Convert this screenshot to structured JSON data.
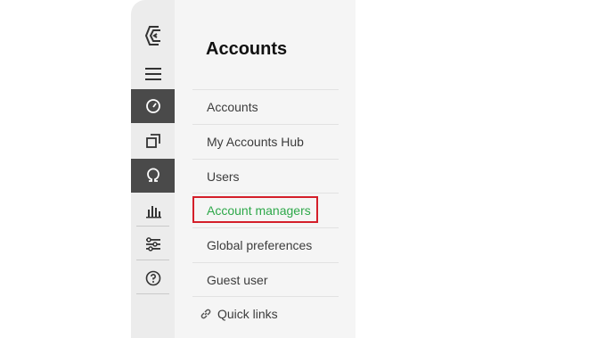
{
  "rail": {
    "items": [
      {
        "icon": "logo-icon"
      },
      {
        "icon": "hamburger-menu-icon"
      },
      {
        "icon": "speedometer-icon",
        "active": true
      },
      {
        "icon": "copy-window-icon"
      },
      {
        "icon": "omega-icon",
        "active": true
      },
      {
        "icon": "bar-chart-icon"
      },
      {
        "icon": "settings-sliders-icon"
      },
      {
        "icon": "help-circle-icon"
      }
    ],
    "active_color": "#4a4a4a"
  },
  "panel": {
    "title": "Accounts",
    "menu": [
      {
        "label": "Accounts"
      },
      {
        "label": "My Accounts Hub"
      },
      {
        "label": "Users"
      },
      {
        "label": "Account managers",
        "selected": true
      },
      {
        "label": "Global preferences"
      },
      {
        "label": "Guest user"
      }
    ],
    "quick_links_label": "Quick links",
    "selected_color": "#2ea84a",
    "highlight_color": "#d41f2a"
  }
}
